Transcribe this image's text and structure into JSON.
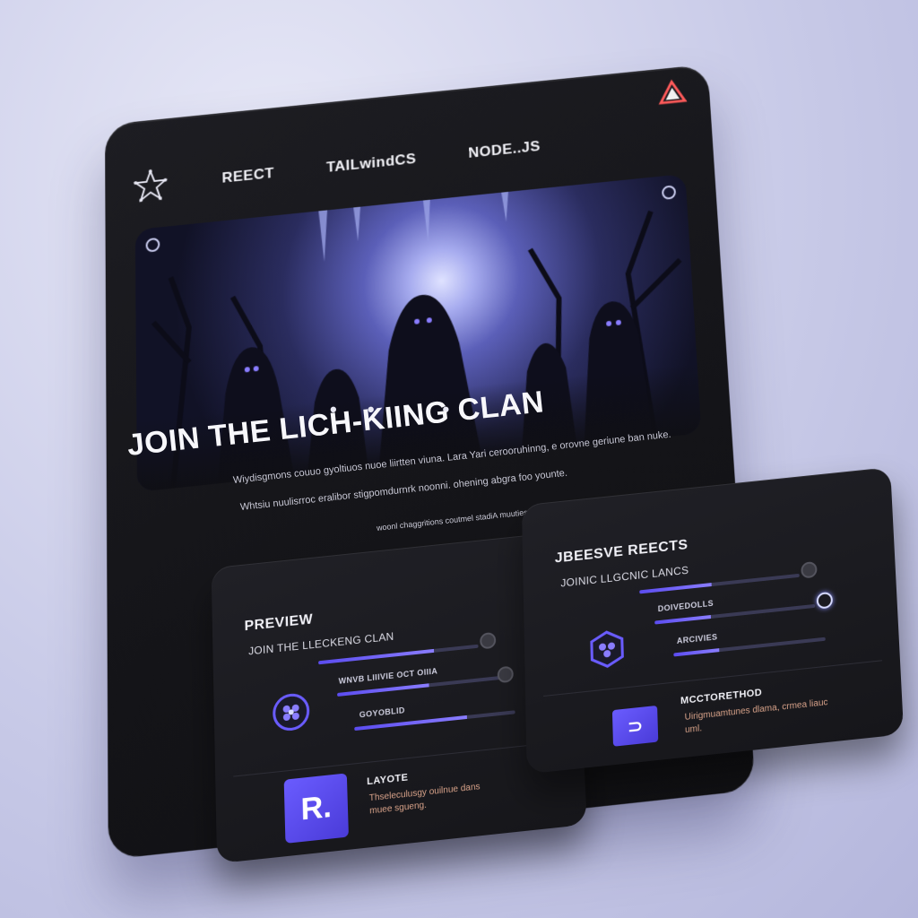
{
  "nav": {
    "items": [
      "REECT",
      "TAILwindCS",
      "NODE..JS"
    ]
  },
  "hero": {
    "dots": "• • • •",
    "title": "JOIN THE LICH-KIING CLAN",
    "text_lines": [
      "Wiydisgmons couuo gyoltiuos nuoe liirtten viuna. Lara Yari cerooruhinng, e orovne geriune ban nuke.",
      "Whtsiu nuulisrroc eralibor stigpomdurnrk noonni. ohening abgra foo younte.",
      "woonl chaggritions coutmel stadiA muuties tomanpontoler."
    ]
  },
  "preview": {
    "title": "PREVIEW",
    "subtitle": "JOIN THE LLECKENG CLAN",
    "row1": "WNVB LIIIVIE OCT OIIIA",
    "row2": "GOYOBLID",
    "bars": [
      0.72,
      0.55,
      0.7
    ],
    "footer_title": "LAYOTE",
    "footer_text": "Thseleculusgy ouilnue dans\nmuee sgueng.",
    "tile_letter": "R."
  },
  "reserve": {
    "title": "JBEESVE REECTS",
    "subtitle": "JOINIC LLGCNIC LANCS",
    "row1": "DOIVEDOLLS",
    "row2": "ARCIVIES",
    "bars": [
      0.45,
      0.35,
      0.3
    ],
    "footer_title": "MCCTORETHOD",
    "footer_text": "Uirigmuamtunes dlama, crmea liauc\numl.",
    "tile_letter": "⊃"
  },
  "colors": {
    "accent": "#6a5cff",
    "card_bg": "#18181c",
    "warm_text": "#d9a38a"
  }
}
